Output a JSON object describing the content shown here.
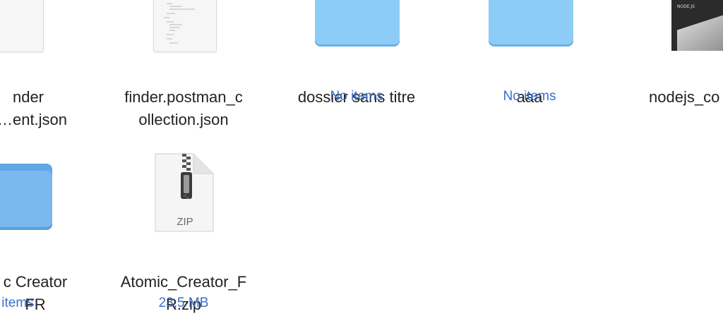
{
  "items": [
    {
      "name_lines": [
        "nder",
        "s…ent.json"
      ],
      "subtitle": ""
    },
    {
      "name_lines": [
        "finder.postman_c",
        "ollection.json"
      ],
      "subtitle": ""
    },
    {
      "name_lines": [
        "dossier sans titre"
      ],
      "subtitle": "No items"
    },
    {
      "name_lines": [
        "aaa"
      ],
      "subtitle": "No items"
    },
    {
      "name_lines": [
        "nodejs_co"
      ],
      "subtitle": ""
    },
    {
      "name_lines": [
        "c Creator",
        "FR"
      ],
      "subtitle": "items"
    },
    {
      "name_lines": [
        "Atomic_Creator_F",
        "R.zip"
      ],
      "subtitle": "23,5 MB"
    }
  ],
  "icons": {
    "zip_label": "ZIP",
    "thumbnail_text": "NODE.JS"
  },
  "colors": {
    "folder": "#8dccf6",
    "subtitle": "#3a6fc8",
    "text": "#222222"
  }
}
